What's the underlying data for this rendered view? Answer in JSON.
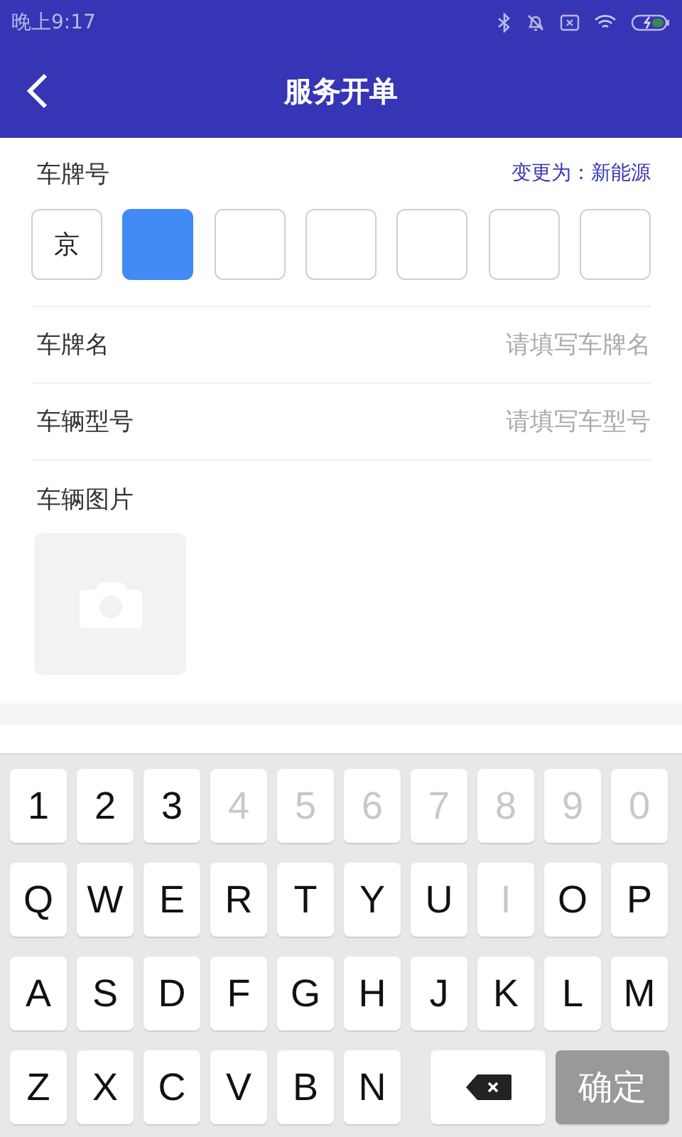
{
  "status_bar": {
    "time": "晚上9:17"
  },
  "header": {
    "title": "服务开单"
  },
  "plate": {
    "label": "车牌号",
    "switch_link": "变更为：新能源",
    "boxes": [
      {
        "text": "京",
        "selected": false
      },
      {
        "selected": true
      },
      {
        "selected": false
      },
      {
        "selected": false
      },
      {
        "selected": false
      },
      {
        "selected": false
      },
      {
        "selected": false
      }
    ]
  },
  "fields": [
    {
      "label": "车牌名",
      "placeholder": "请填写车牌名"
    },
    {
      "label": "车辆型号",
      "placeholder": "请填写车型号"
    }
  ],
  "photo": {
    "label": "车辆图片"
  },
  "keyboard": {
    "rows": [
      [
        {
          "key": "1",
          "disabled": false
        },
        {
          "key": "2",
          "disabled": false
        },
        {
          "key": "3",
          "disabled": false
        },
        {
          "key": "4",
          "disabled": true
        },
        {
          "key": "5",
          "disabled": true
        },
        {
          "key": "6",
          "disabled": true
        },
        {
          "key": "7",
          "disabled": true
        },
        {
          "key": "8",
          "disabled": true
        },
        {
          "key": "9",
          "disabled": true
        },
        {
          "key": "0",
          "disabled": true
        }
      ],
      [
        {
          "key": "Q",
          "disabled": false
        },
        {
          "key": "W",
          "disabled": false
        },
        {
          "key": "E",
          "disabled": false
        },
        {
          "key": "R",
          "disabled": false
        },
        {
          "key": "T",
          "disabled": false
        },
        {
          "key": "Y",
          "disabled": false
        },
        {
          "key": "U",
          "disabled": false
        },
        {
          "key": "I",
          "disabled": true
        },
        {
          "key": "O",
          "disabled": false
        },
        {
          "key": "P",
          "disabled": false
        }
      ],
      [
        {
          "key": "A",
          "disabled": false
        },
        {
          "key": "S",
          "disabled": false
        },
        {
          "key": "D",
          "disabled": false
        },
        {
          "key": "F",
          "disabled": false
        },
        {
          "key": "G",
          "disabled": false
        },
        {
          "key": "H",
          "disabled": false
        },
        {
          "key": "J",
          "disabled": false
        },
        {
          "key": "K",
          "disabled": false
        },
        {
          "key": "L",
          "disabled": false
        },
        {
          "key": "M",
          "disabled": false
        }
      ],
      [
        {
          "key": "Z",
          "disabled": false
        },
        {
          "key": "X",
          "disabled": false
        },
        {
          "key": "C",
          "disabled": false
        },
        {
          "key": "V",
          "disabled": false
        },
        {
          "key": "B",
          "disabled": false
        },
        {
          "key": "N",
          "disabled": false
        }
      ]
    ],
    "confirm": "确定"
  }
}
